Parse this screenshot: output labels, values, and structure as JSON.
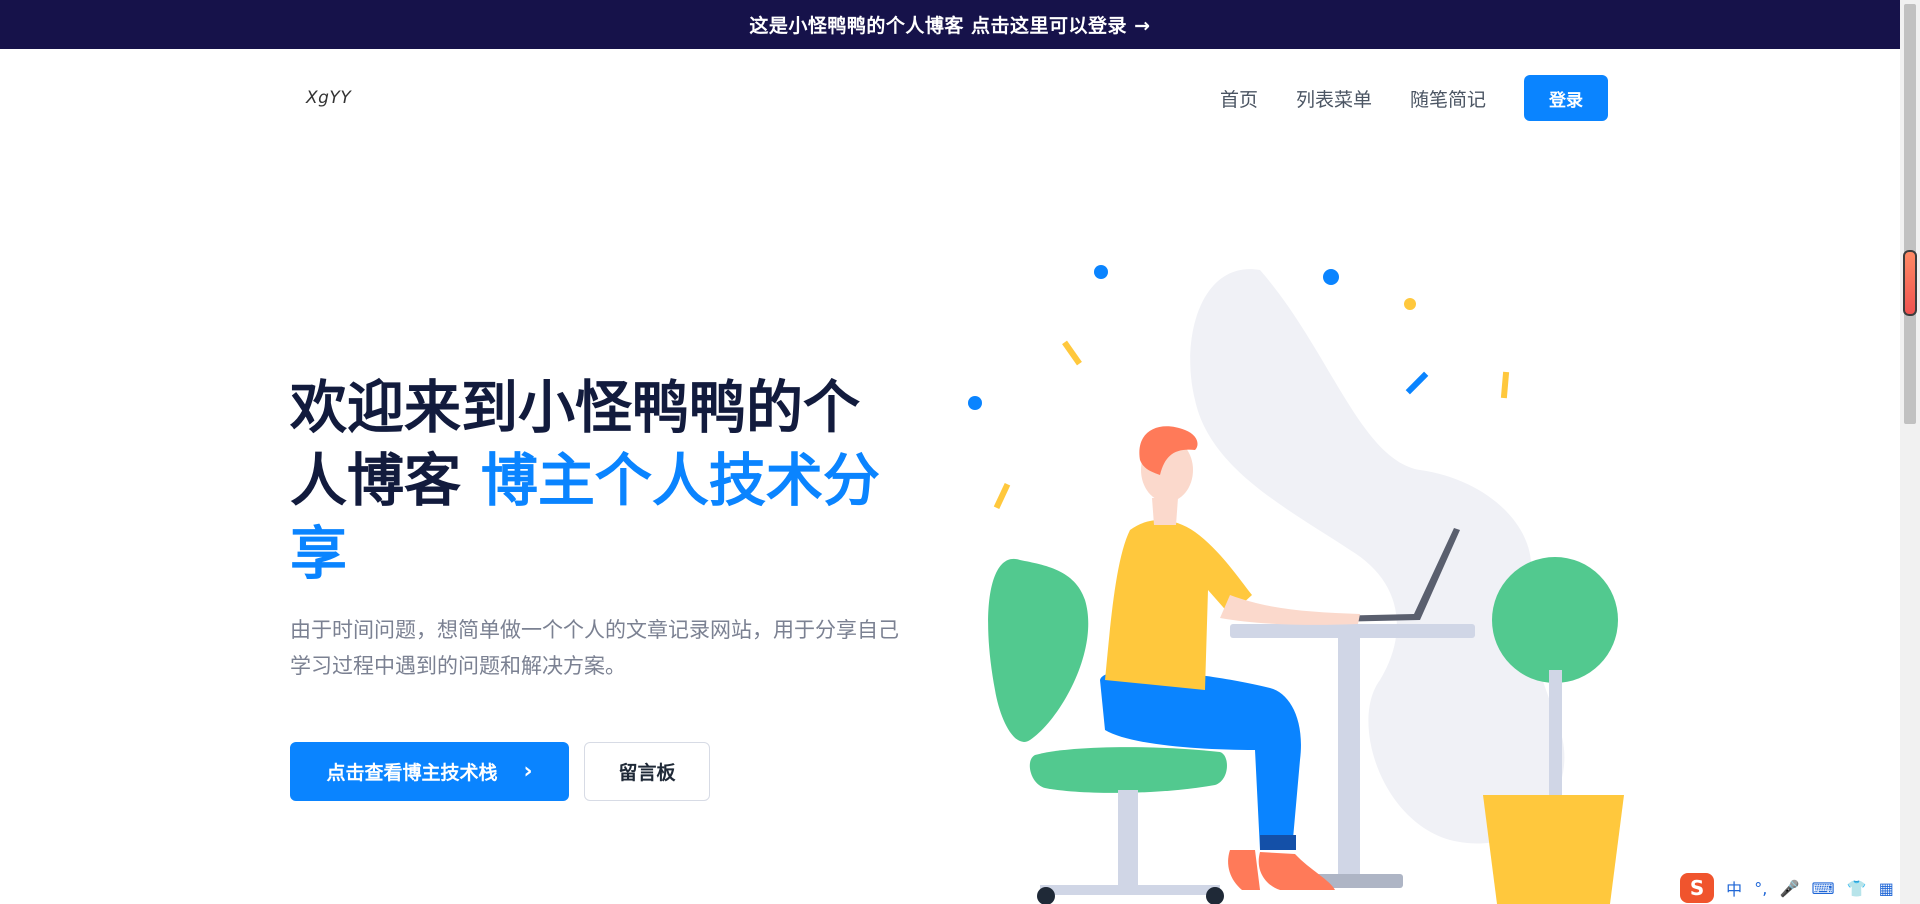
{
  "announcement": {
    "text": "这是小怪鸭鸭的个人博客 点击这里可以登录 →"
  },
  "header": {
    "logo": "XgYY",
    "nav": [
      {
        "label": "首页"
      },
      {
        "label": "列表菜单"
      },
      {
        "label": "随笔简记"
      }
    ],
    "login_label": "登录"
  },
  "hero": {
    "title_main": "欢迎来到小怪鸭鸭的个人博客 ",
    "title_accent": "博主个人技术分享",
    "description": "由于时间问题，想简单做一个个人的文章记录网站，用于分享自己学习过程中遇到的问题和解决方案。",
    "primary_button": "点击查看博主技术栈",
    "secondary_button": "留言板"
  },
  "ime": {
    "lang": "中",
    "punct": "°,"
  },
  "colors": {
    "brand": "#0a84ff",
    "banner": "#16124a",
    "title": "#121b3d"
  }
}
